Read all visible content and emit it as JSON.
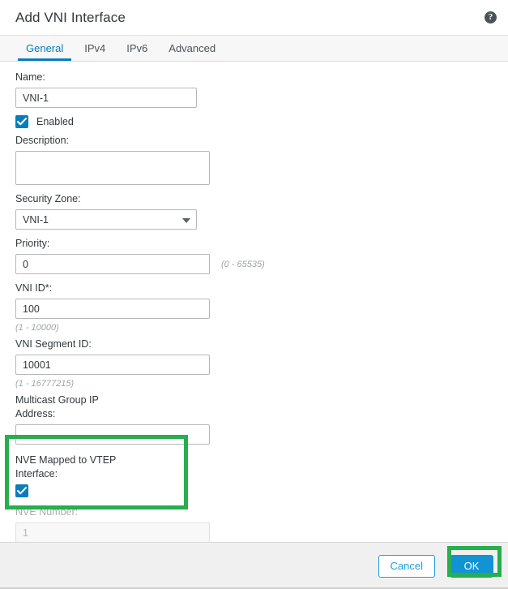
{
  "dialog": {
    "title": "Add VNI Interface",
    "help_icon": "help-circle-icon"
  },
  "tabs": [
    {
      "label": "General",
      "active": true
    },
    {
      "label": "IPv4",
      "active": false
    },
    {
      "label": "IPv6",
      "active": false
    },
    {
      "label": "Advanced",
      "active": false
    }
  ],
  "form": {
    "name": {
      "label": "Name:",
      "value": "VNI-1",
      "placeholder": ""
    },
    "enabled": {
      "label": "Enabled",
      "checked": true
    },
    "description": {
      "label": "Description:",
      "value": "",
      "placeholder": ""
    },
    "security_zone": {
      "label": "Security Zone:",
      "value": "VNI-1"
    },
    "priority": {
      "label": "Priority:",
      "value": "0",
      "hint": "(0 - 65535)"
    },
    "vni_id": {
      "label": "VNI ID*:",
      "value": "100",
      "hint": "(1 - 10000)"
    },
    "vni_segment_id": {
      "label": "VNI Segment ID:",
      "value": "10001",
      "hint": "(1 - 16777215)"
    },
    "multicast_group_ip": {
      "label": "Multicast Group IP Address:",
      "value": "",
      "placeholder": ""
    },
    "nve_mapped": {
      "label": "NVE Mapped to VTEP Interface:",
      "checked": true
    },
    "nve_number": {
      "label": "NVE Number:",
      "value": "1",
      "disabled": true
    }
  },
  "footer": {
    "cancel_label": "Cancel",
    "ok_label": "OK"
  },
  "colors": {
    "accent_blue": "#0a7dbb",
    "button_blue": "#1294d4",
    "cancel_blue": "#1ba0e0",
    "highlight_green": "#27ae4d",
    "checkbox_blue": "#0a7dbb"
  }
}
